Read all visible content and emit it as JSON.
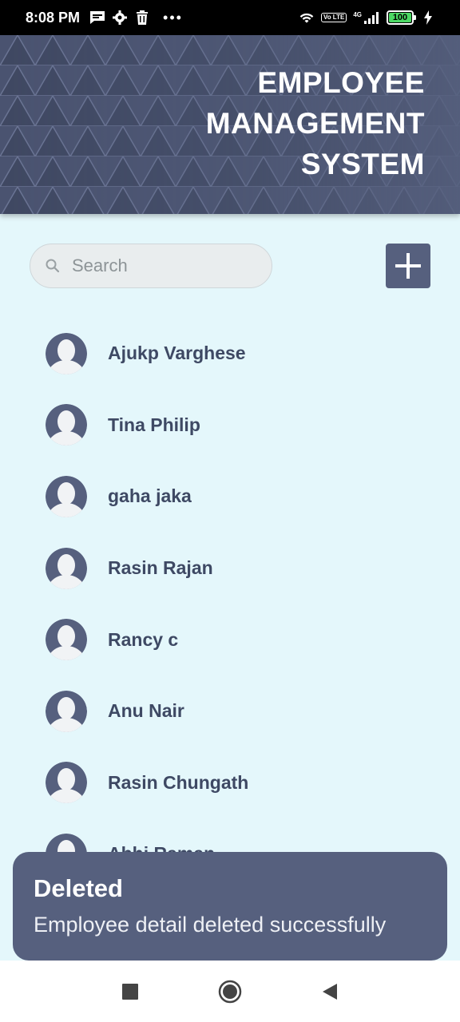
{
  "status_bar": {
    "time": "8:08 PM",
    "left_icons": [
      "message-icon",
      "settings-icon",
      "trash-icon"
    ],
    "more": "•••",
    "volte": "Vo LTE",
    "network": "4G",
    "battery": "100"
  },
  "header": {
    "title_lines": [
      "EMPLOYEE",
      "MANAGEMENT",
      "SYSTEM"
    ],
    "background_color": "#56607e"
  },
  "search": {
    "placeholder": "Search",
    "value": ""
  },
  "add_button": {
    "icon": "plus-icon"
  },
  "employees": [
    {
      "name": "Ajukp Varghese"
    },
    {
      "name": "Tina Philip"
    },
    {
      "name": "gaha jaka"
    },
    {
      "name": "Rasin Rajan"
    },
    {
      "name": "Rancy c"
    },
    {
      "name": "Anu Nair"
    },
    {
      "name": "Rasin Chungath"
    },
    {
      "name": "Abhi Raman"
    }
  ],
  "snackbar": {
    "title": "Deleted",
    "message": "Employee detail deleted successfully"
  },
  "nav_bar": {
    "buttons": [
      "recents-square-icon",
      "home-circle-icon",
      "back-triangle-icon"
    ]
  },
  "colors": {
    "accent": "#56607e",
    "page_background": "#e4f7fb",
    "name_text": "#3e4964"
  }
}
